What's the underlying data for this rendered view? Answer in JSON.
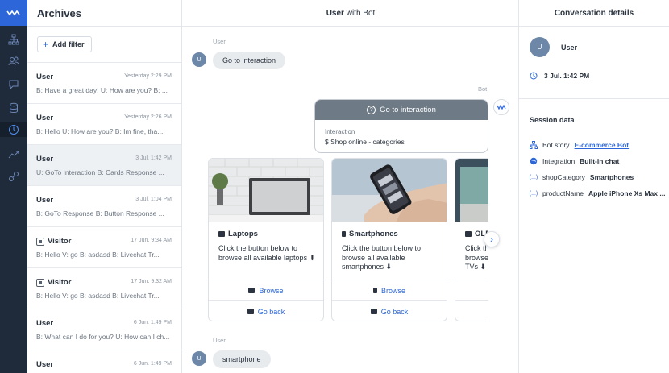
{
  "archives": {
    "title": "Archives",
    "add_filter": "Add filter",
    "items": [
      {
        "name": "User",
        "time": "Yesterday 2:29 PM",
        "preview": "B: Have a great day!  U: How are you?  B: ...",
        "visitor": false
      },
      {
        "name": "User",
        "time": "Yesterday 2:26 PM",
        "preview": "B: Hello  U: How are you?  B: Im fine, tha...",
        "visitor": false
      },
      {
        "name": "User",
        "time": "3 Jul. 1:42 PM",
        "preview": "U: GoTo Interaction  B: Cards Response  ...",
        "visitor": false
      },
      {
        "name": "User",
        "time": "3 Jul. 1:04 PM",
        "preview": "B: GoTo Response  B: Button Response  ...",
        "visitor": false
      },
      {
        "name": "Visitor",
        "time": "17 Jun. 9:34 AM",
        "preview": "B: Hello  V: go  B: asdasd  B: Livechat Tr...",
        "visitor": true
      },
      {
        "name": "Visitor",
        "time": "17 Jun. 9:32 AM",
        "preview": "B: Hello  V: go  B: asdasd  B: Livechat Tr...",
        "visitor": true
      },
      {
        "name": "User",
        "time": "6 Jun. 1:49 PM",
        "preview": "B: What can I do for you?  U: How can I ch...",
        "visitor": false
      },
      {
        "name": "User",
        "time": "6 Jun. 1:49 PM",
        "preview": "",
        "visitor": false
      }
    ]
  },
  "conversation": {
    "header_name": "User",
    "header_rest": " with Bot",
    "user_label_1": "User",
    "avatar_letter": "U",
    "user_msg_1": "Go to interaction",
    "bot_label": "Bot",
    "bot_card_title": "Go to interaction",
    "bot_card_sub": "Interaction",
    "bot_card_value": "$ Shop online - categories",
    "cards": [
      {
        "title": "Laptops",
        "desc": "Click the button below to browse all available laptops ⬇",
        "btn1": "Browse",
        "btn2": "Go back"
      },
      {
        "title": "Smartphones",
        "desc": "Click the button below to browse all available smartphones ⬇",
        "btn1": "Browse",
        "btn2": "Go back"
      },
      {
        "title": "OLE",
        "desc": "Click th browse TVs ⬇",
        "btn1": "",
        "btn2": ""
      }
    ],
    "user_label_2": "User",
    "user_msg_2": "smartphone"
  },
  "details": {
    "title": "Conversation details",
    "user": "User",
    "avatar_letter": "U",
    "date": "3 Jul. 1:42 PM",
    "session_title": "Session data",
    "rows": [
      {
        "key": "Bot story",
        "value": "E-commerce Bot",
        "link": true,
        "icon": "story-icon"
      },
      {
        "key": "Integration",
        "value": "Built-in chat",
        "link": false,
        "icon": "globe-icon"
      },
      {
        "key": "shopCategory",
        "value": "Smartphones",
        "link": false,
        "icon": "variable-icon"
      },
      {
        "key": "productName",
        "value": "Apple iPhone Xs Max ...",
        "link": false,
        "icon": "variable-icon"
      }
    ]
  },
  "colors": {
    "rail": "#1f2b3a",
    "accent": "#2c66d8",
    "bot_header": "#6e7a86"
  }
}
